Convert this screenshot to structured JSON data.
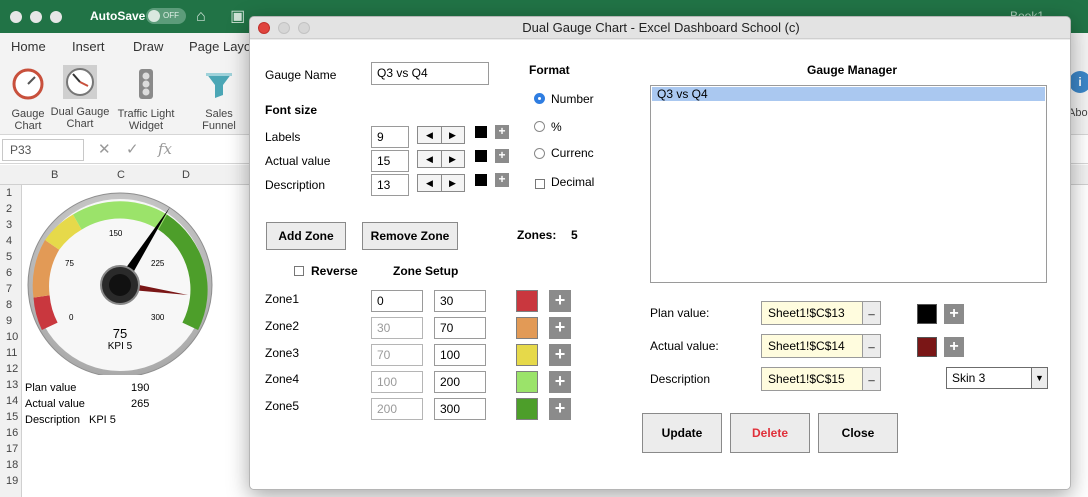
{
  "excel": {
    "autosave_label": "AutoSave",
    "autosave_state": "OFF",
    "doc_title": "Book1",
    "tabs": [
      "Home",
      "Insert",
      "Draw",
      "Page Layo"
    ],
    "ribbon_buttons": [
      {
        "label": "Gauge Chart"
      },
      {
        "label": "Dual Gauge Chart"
      },
      {
        "label": "Traffic Light Widget"
      },
      {
        "label": "Sales Funnel"
      }
    ],
    "right_button_label": "Abo",
    "name_box": "P33",
    "columns": [
      "B",
      "C",
      "D"
    ],
    "rows": [
      "1",
      "2",
      "3",
      "4",
      "5",
      "6",
      "7",
      "8",
      "9",
      "10",
      "11",
      "12",
      "13",
      "14",
      "15",
      "16",
      "17",
      "18",
      "19"
    ],
    "cells": {
      "plan_label": "Plan value",
      "plan_value": "190",
      "actual_label": "Actual value",
      "actual_value": "265",
      "desc_label": "Description",
      "desc_value": "KPI 5"
    },
    "gauge": {
      "tick_labels": [
        "0",
        "75",
        "150",
        "225",
        "300"
      ],
      "value_text": "75",
      "caption": "KPI 5",
      "zone_colors": [
        "#c9373e",
        "#e29a56",
        "#e6d94a",
        "#9be36a",
        "#4d9e2a"
      ]
    }
  },
  "dialog": {
    "title": "Dual Gauge Chart - Excel Dashboard School (c)",
    "gauge_name_label": "Gauge Name",
    "gauge_name_value": "Q3 vs Q4",
    "font_size_heading": "Font size",
    "font_rows": [
      {
        "label": "Labels",
        "value": "9",
        "color": "#000000"
      },
      {
        "label": "Actual value",
        "value": "15",
        "color": "#000000"
      },
      {
        "label": "Description",
        "value": "13",
        "color": "#000000"
      }
    ],
    "format_heading": "Format",
    "format_options": [
      {
        "label": "Number",
        "checked": true
      },
      {
        "label": "%",
        "checked": false
      },
      {
        "label": "Currenc",
        "checked": false
      }
    ],
    "decimal_label": "Decimal",
    "add_zone": "Add Zone",
    "remove_zone": "Remove Zone",
    "zones_label": "Zones:",
    "zones_count": "5",
    "reverse_label": "Reverse",
    "zone_setup": "Zone Setup",
    "zones": [
      {
        "label": "Zone1",
        "from": "0",
        "to": "30",
        "from_enabled": true,
        "color": "#c9373e"
      },
      {
        "label": "Zone2",
        "from": "30",
        "to": "70",
        "from_enabled": false,
        "color": "#e29a56"
      },
      {
        "label": "Zone3",
        "from": "70",
        "to": "100",
        "from_enabled": false,
        "color": "#e6d94a"
      },
      {
        "label": "Zone4",
        "from": "100",
        "to": "200",
        "from_enabled": false,
        "color": "#9be36a"
      },
      {
        "label": "Zone5",
        "from": "200",
        "to": "300",
        "from_enabled": false,
        "color": "#4d9e2a"
      }
    ],
    "manager_heading": "Gauge Manager",
    "manager_items": [
      "Q3 vs Q4"
    ],
    "plan_label": "Plan value:",
    "plan_ref": "Sheet1!$C$13",
    "plan_color": "#000000",
    "actual_label": "Actual value:",
    "actual_ref": "Sheet1!$C$14",
    "actual_color": "#7a1616",
    "description_label": "Description",
    "description_ref": "Sheet1!$C$15",
    "skin": "Skin 3",
    "update": "Update",
    "delete": "Delete",
    "close": "Close"
  }
}
